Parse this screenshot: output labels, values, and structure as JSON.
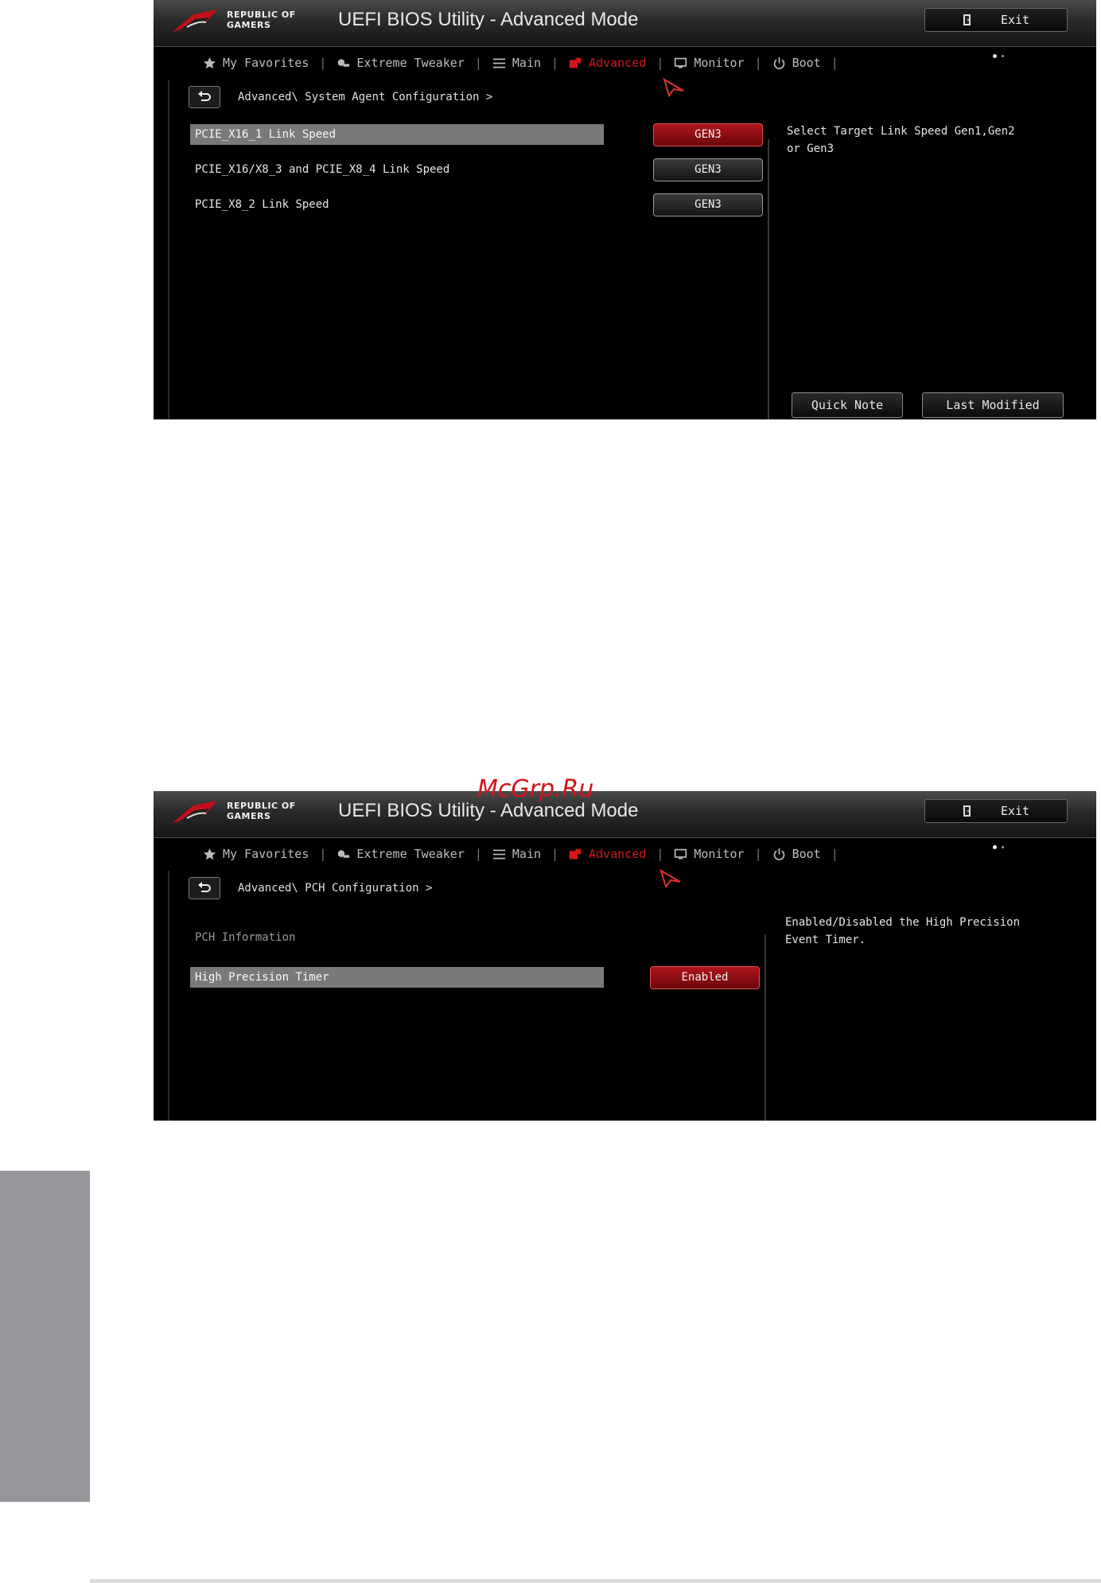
{
  "screens": [
    {
      "brand_line1": "REPUBLIC OF",
      "brand_line2": "GAMERS",
      "title": "UEFI BIOS Utility - Advanced Mode",
      "exit_label": "Exit",
      "tabs": [
        {
          "label": "My Favorites",
          "icon": "star-icon"
        },
        {
          "label": "Extreme Tweaker",
          "icon": "tweaker-icon"
        },
        {
          "label": "Main",
          "icon": "list-icon"
        },
        {
          "label": "Advanced",
          "icon": "advanced-icon",
          "active": true
        },
        {
          "label": "Monitor",
          "icon": "monitor-icon"
        },
        {
          "label": "Boot",
          "icon": "power-icon"
        }
      ],
      "breadcrumb": "Advanced\\ System Agent Configuration >",
      "rows": [
        {
          "label": "PCIE_X16_1 Link Speed",
          "value": "GEN3",
          "selected": true
        },
        {
          "label": "PCIE_X16/X8_3 and PCIE_X8_4 Link Speed",
          "value": "GEN3",
          "selected": false
        },
        {
          "label": "PCIE_X8_2 Link Speed",
          "value": "GEN3",
          "selected": false
        }
      ],
      "help_line1": "Select Target Link Speed Gen1,Gen2",
      "help_line2": "or Gen3",
      "quick_note_label": "Quick Note",
      "last_modified_label": "Last Modified"
    },
    {
      "brand_line1": "REPUBLIC OF",
      "brand_line2": "GAMERS",
      "title": "UEFI BIOS Utility - Advanced Mode",
      "exit_label": "Exit",
      "tabs": [
        {
          "label": "My Favorites",
          "icon": "star-icon"
        },
        {
          "label": "Extreme Tweaker",
          "icon": "tweaker-icon"
        },
        {
          "label": "Main",
          "icon": "list-icon"
        },
        {
          "label": "Advanced",
          "icon": "advanced-icon",
          "active": true
        },
        {
          "label": "Monitor",
          "icon": "monitor-icon"
        },
        {
          "label": "Boot",
          "icon": "power-icon"
        }
      ],
      "breadcrumb": "Advanced\\ PCH Configuration >",
      "section_label": "PCH Information",
      "rows": [
        {
          "label": "High Precision Timer",
          "value": "Enabled",
          "selected": true
        }
      ],
      "help_line1": "Enabled/Disabled the High Precision",
      "help_line2": "Event Timer."
    }
  ],
  "watermark": "McGrp.Ru",
  "colors": {
    "accent_red": "#d4141e",
    "selected_row": "#7a7a7a",
    "side_tab": "#95969a"
  }
}
